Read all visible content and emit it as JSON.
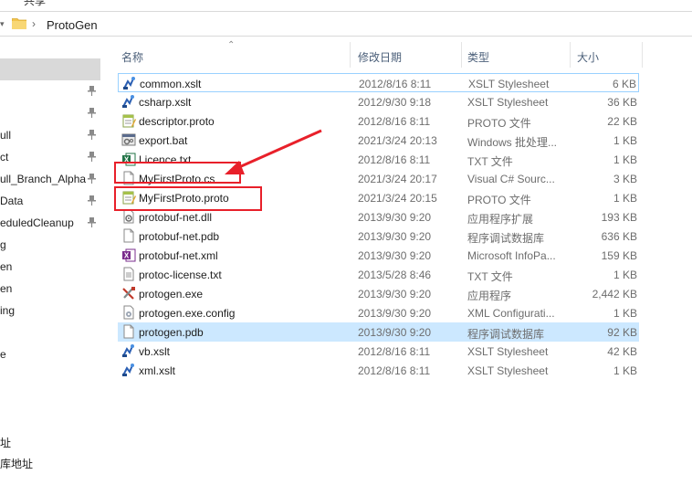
{
  "ribbon": {
    "partial_label": "共享"
  },
  "address": {
    "path": "ProtoGen"
  },
  "nav": {
    "items": [
      {
        "label": "",
        "pinned": false,
        "selected": true
      },
      {
        "label": "",
        "pinned": true
      },
      {
        "label": "",
        "pinned": true
      },
      {
        "label": "ull",
        "pinned": true
      },
      {
        "label": "ct",
        "pinned": true
      },
      {
        "label": "ull_Branch_Alpha",
        "pinned": true
      },
      {
        "label": "Data",
        "pinned": true
      },
      {
        "label": "eduledCleanup",
        "pinned": true
      },
      {
        "label": "g",
        "pinned": false
      },
      {
        "label": "en",
        "pinned": false
      },
      {
        "label": "en",
        "pinned": false
      },
      {
        "label": "ing",
        "pinned": false
      },
      {
        "label": "",
        "pinned": false
      },
      {
        "label": "e",
        "pinned": false
      }
    ],
    "bottom_items": [
      {
        "label": ""
      },
      {
        "label": "址"
      },
      {
        "label": "库地址"
      }
    ]
  },
  "columns": {
    "name": "名称",
    "modified": "修改日期",
    "type": "类型",
    "size": "大小"
  },
  "files": [
    {
      "name": "common.xslt",
      "modified": "2012/8/16 8:11",
      "type": "XSLT Stylesheet",
      "size": "6 KB",
      "icon": "xslt-icon",
      "state": "boxed"
    },
    {
      "name": "csharp.xslt",
      "modified": "2012/9/30 9:18",
      "type": "XSLT Stylesheet",
      "size": "36 KB",
      "icon": "xslt-icon"
    },
    {
      "name": "descriptor.proto",
      "modified": "2012/8/16 8:11",
      "type": "PROTO 文件",
      "size": "22 KB",
      "icon": "notepad-icon"
    },
    {
      "name": "export.bat",
      "modified": "2021/3/24 20:13",
      "type": "Windows 批处理...",
      "size": "1 KB",
      "icon": "batch-icon"
    },
    {
      "name": "Licence.txt",
      "modified": "2012/8/16 8:11",
      "type": "TXT 文件",
      "size": "1 KB",
      "icon": "excel-icon"
    },
    {
      "name": "MyFirstProto.cs",
      "modified": "2021/3/24 20:17",
      "type": "Visual C# Sourc...",
      "size": "3 KB",
      "icon": "file-icon"
    },
    {
      "name": "MyFirstProto.proto",
      "modified": "2021/3/24 20:15",
      "type": "PROTO 文件",
      "size": "1 KB",
      "icon": "notepad-icon"
    },
    {
      "name": "protobuf-net.dll",
      "modified": "2013/9/30 9:20",
      "type": "应用程序扩展",
      "size": "193 KB",
      "icon": "dll-icon"
    },
    {
      "name": "protobuf-net.pdb",
      "modified": "2013/9/30 9:20",
      "type": "程序调试数据库",
      "size": "636 KB",
      "icon": "file-icon"
    },
    {
      "name": "protobuf-net.xml",
      "modified": "2013/9/30 9:20",
      "type": "Microsoft InfoPa...",
      "size": "159 KB",
      "icon": "infopath-icon"
    },
    {
      "name": "protoc-license.txt",
      "modified": "2013/5/28 8:46",
      "type": "TXT 文件",
      "size": "1 KB",
      "icon": "text-icon"
    },
    {
      "name": "protogen.exe",
      "modified": "2013/9/30 9:20",
      "type": "应用程序",
      "size": "2,442 KB",
      "icon": "exe-icon"
    },
    {
      "name": "protogen.exe.config",
      "modified": "2013/9/30 9:20",
      "type": "XML Configurati...",
      "size": "1 KB",
      "icon": "config-icon"
    },
    {
      "name": "protogen.pdb",
      "modified": "2013/9/30 9:20",
      "type": "程序调试数据库",
      "size": "92 KB",
      "icon": "file-icon",
      "state": "selected"
    },
    {
      "name": "vb.xslt",
      "modified": "2012/8/16 8:11",
      "type": "XSLT Stylesheet",
      "size": "42 KB",
      "icon": "xslt-icon"
    },
    {
      "name": "xml.xslt",
      "modified": "2012/8/16 8:11",
      "type": "XSLT Stylesheet",
      "size": "1 KB",
      "icon": "xslt-icon"
    }
  ],
  "colors": {
    "annotation": "#e8202a",
    "selection": "#cce8ff",
    "selection_border": "#99d1ff",
    "header_text": "#4c607a"
  }
}
